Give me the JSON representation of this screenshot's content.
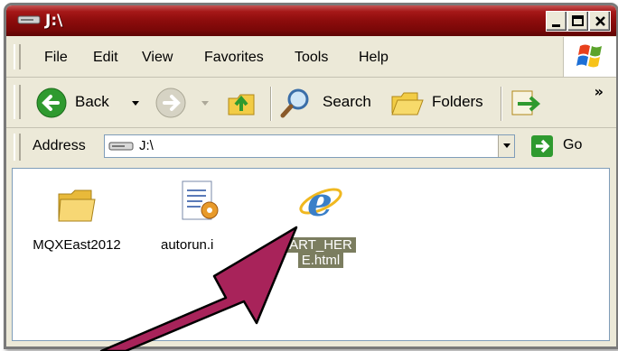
{
  "window": {
    "title": "J:\\"
  },
  "menubar": {
    "items": [
      "File",
      "Edit",
      "View",
      "Favorites",
      "Tools",
      "Help"
    ]
  },
  "toolbar": {
    "back_label": "Back",
    "search_label": "Search",
    "folders_label": "Folders",
    "chevron": "»"
  },
  "address": {
    "label": "Address",
    "value": "J:\\",
    "go_label": "Go"
  },
  "files": [
    {
      "name": "MQXEast2012",
      "icon": "folder-icon"
    },
    {
      "name": "autorun.inf",
      "visible_text": "autorun.i",
      "icon": "setup-info-icon"
    },
    {
      "name": "START_HERE.html",
      "line1": "ART_HER",
      "line2": "E.html",
      "icon": "ie-html-icon",
      "selected": true
    }
  ],
  "colors": {
    "titlebar": "#8c0c0c",
    "arrow": "#a8235a",
    "selection": "#7b7d5f"
  }
}
